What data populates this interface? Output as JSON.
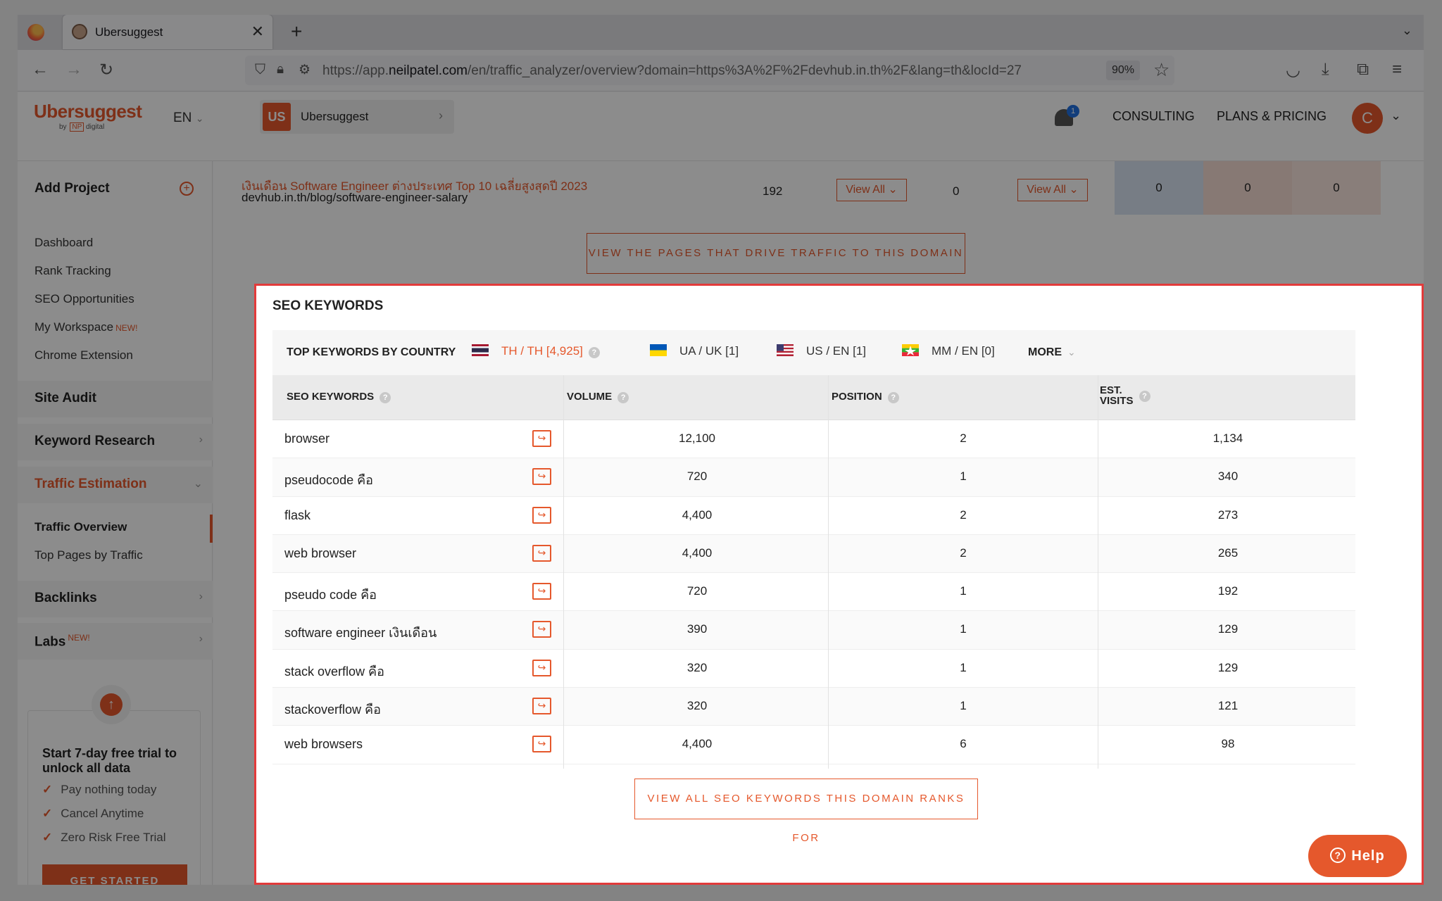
{
  "browser": {
    "tab_title": "Ubersuggest",
    "url_prefix": "https://app.",
    "url_domain": "neilpatel.com",
    "url_rest": "/en/traffic_analyzer/overview?domain=https%3A%2F%2Fdevhub.in.th%2F&lang=th&locId=27",
    "zoom": "90%"
  },
  "header": {
    "logo": "Ubersuggest",
    "logo_by": "by",
    "logo_np": "NP",
    "logo_digital": "digital",
    "lang": "EN",
    "project_badge": "US",
    "project_name": "Ubersuggest",
    "notifications": "1",
    "consulting": "CONSULTING",
    "plans": "PLANS & PRICING",
    "avatar": "C"
  },
  "sidebar": {
    "add_project": "Add Project",
    "links": [
      "Dashboard",
      "Rank Tracking",
      "SEO Opportunities",
      "My Workspace",
      "Chrome Extension"
    ],
    "new_badge": "NEW!",
    "sections": {
      "site_audit": "Site Audit",
      "keyword_research": "Keyword Research",
      "traffic_estimation": "Traffic Estimation",
      "backlinks": "Backlinks",
      "labs": "Labs"
    },
    "sub_links": [
      "Traffic Overview",
      "Top Pages by Traffic"
    ],
    "trial": {
      "title": "Start 7-day free trial to unlock all data",
      "items": [
        "Pay nothing today",
        "Cancel Anytime",
        "Zero Risk Free Trial"
      ],
      "button": "GET STARTED"
    }
  },
  "top_pages_row": {
    "title": "เงินเดือน Software Engineer ต่างประเทศ Top 10 เฉลี่ยสูงสุดปี 2023",
    "url": "devhub.in.th/blog/software-engineer-salary",
    "count1": "192",
    "view_all": "View All",
    "count2": "0",
    "cells": [
      "0",
      "0",
      "0"
    ],
    "button": "VIEW THE PAGES THAT DRIVE TRAFFIC TO THIS DOMAIN"
  },
  "seo": {
    "title": "SEO KEYWORDS",
    "country_label": "TOP KEYWORDS BY COUNTRY",
    "countries": [
      {
        "label": "TH / TH  [4,925]"
      },
      {
        "label": "UA / UK  [1]"
      },
      {
        "label": "US / EN  [1]"
      },
      {
        "label": "MM / EN  [0]"
      }
    ],
    "more": "MORE",
    "columns": {
      "keyword": "SEO KEYWORDS",
      "volume": "VOLUME",
      "position": "POSITION",
      "visits_1": "EST.",
      "visits_2": "VISITS"
    },
    "rows": [
      {
        "keyword": "browser",
        "volume": "12,100",
        "position": "2",
        "visits": "1,134"
      },
      {
        "keyword": "pseudocode คือ",
        "volume": "720",
        "position": "1",
        "visits": "340"
      },
      {
        "keyword": "flask",
        "volume": "4,400",
        "position": "2",
        "visits": "273"
      },
      {
        "keyword": "web browser",
        "volume": "4,400",
        "position": "2",
        "visits": "265"
      },
      {
        "keyword": "pseudo code คือ",
        "volume": "720",
        "position": "1",
        "visits": "192"
      },
      {
        "keyword": "software engineer เงินเดือน",
        "volume": "390",
        "position": "1",
        "visits": "129"
      },
      {
        "keyword": "stack overflow คือ",
        "volume": "320",
        "position": "1",
        "visits": "129"
      },
      {
        "keyword": "stackoverflow คือ",
        "volume": "320",
        "position": "1",
        "visits": "121"
      },
      {
        "keyword": "web browsers",
        "volume": "4,400",
        "position": "6",
        "visits": "98"
      }
    ],
    "button": "VIEW ALL SEO KEYWORDS THIS DOMAIN RANKS FOR"
  },
  "help": "Help",
  "colors": {
    "accent": "#e5582c",
    "highlight_border": "#e23b3b"
  }
}
